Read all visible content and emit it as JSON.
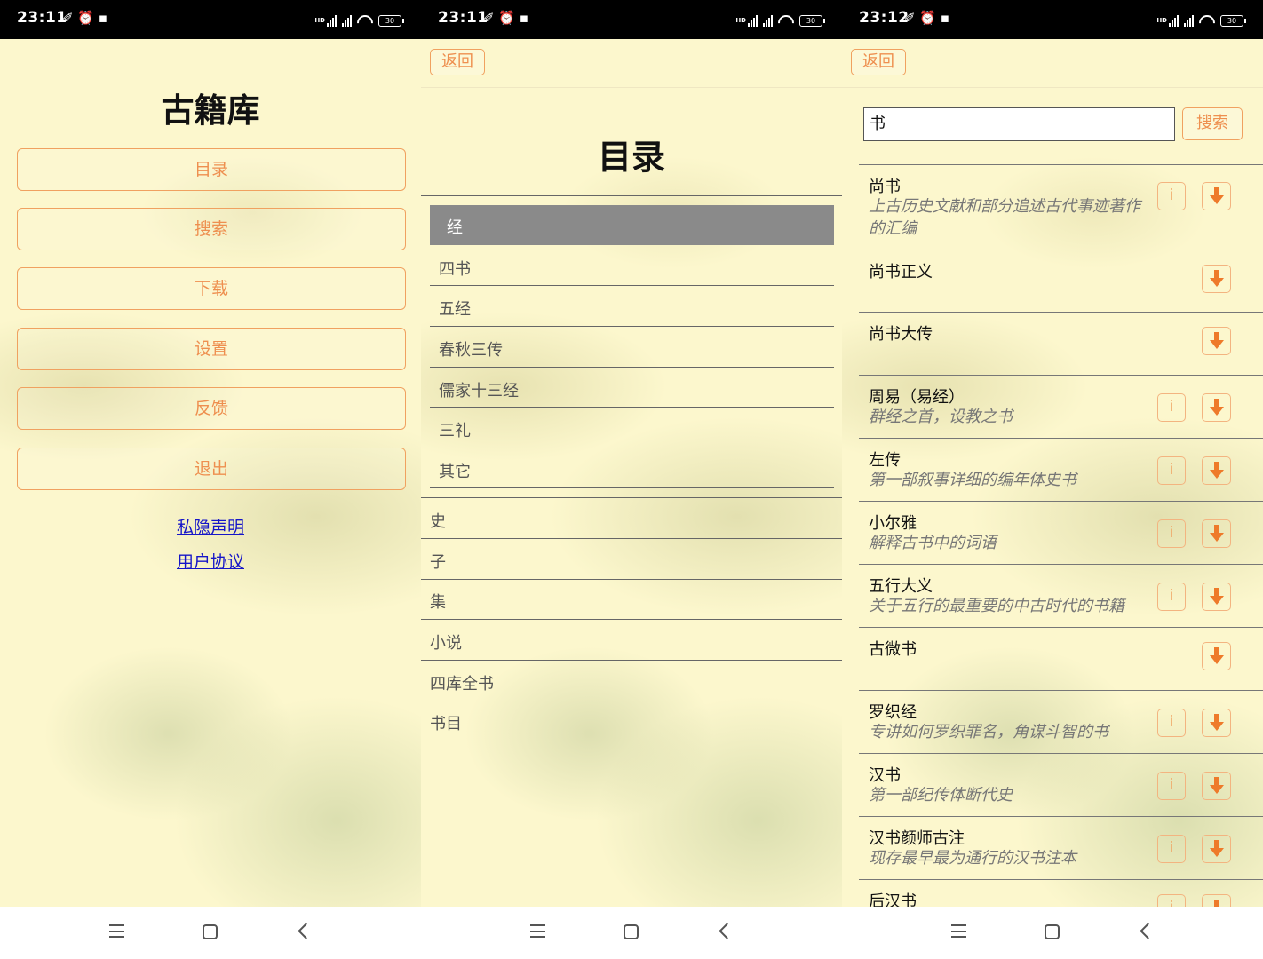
{
  "status_bars": [
    {
      "time": "23:11",
      "battery": "30"
    },
    {
      "time": "23:11",
      "battery": "30"
    },
    {
      "time": "23:12",
      "battery": "30"
    }
  ],
  "status_icons": "✐ ⏰ ▪",
  "home": {
    "title": "古籍库",
    "buttons": [
      "目录",
      "搜索",
      "下载",
      "设置",
      "反馈",
      "退出"
    ],
    "links": [
      "私隐声明",
      "用户协议"
    ]
  },
  "catalog": {
    "back_label": "返回",
    "title": "目录",
    "selected": "经",
    "sub_items": [
      "四书",
      "五经",
      "春秋三传",
      "儒家十三经",
      "三礼",
      "其它"
    ],
    "main_items": [
      "史",
      "子",
      "集",
      "小说",
      "四库全书",
      "书目"
    ]
  },
  "search": {
    "back_label": "返回",
    "query": "书",
    "button_label": "搜索",
    "results": [
      {
        "title": "尚书",
        "desc": "上古历史文献和部分追述古代事迹著作的汇编",
        "info": true
      },
      {
        "title": "尚书正义",
        "desc": "",
        "info": false
      },
      {
        "title": "尚书大传",
        "desc": "",
        "info": false
      },
      {
        "title": "周易（易经）",
        "desc": "群经之首，设教之书",
        "info": true
      },
      {
        "title": "左传",
        "desc": "第一部叙事详细的编年体史书",
        "info": true
      },
      {
        "title": "小尔雅",
        "desc": "解释古书中的词语",
        "info": true
      },
      {
        "title": "五行大义",
        "desc": "关于五行的最重要的中古时代的书籍",
        "info": true
      },
      {
        "title": "古微书",
        "desc": "",
        "info": false
      },
      {
        "title": "罗织经",
        "desc": "专讲如何罗织罪名，角谋斗智的书",
        "info": true
      },
      {
        "title": "汉书",
        "desc": "第一部纪传体断代史",
        "info": true
      },
      {
        "title": "汉书颜师古注",
        "desc": "现存最早最为通行的汉书注本",
        "info": true
      },
      {
        "title": "后汉书",
        "desc": "",
        "info": true
      }
    ],
    "info_label": "i"
  },
  "colors": {
    "accent": "#ee8f4f",
    "background": "#fcf7cd",
    "selected": "#8a8a8a",
    "link": "#1515c8"
  }
}
